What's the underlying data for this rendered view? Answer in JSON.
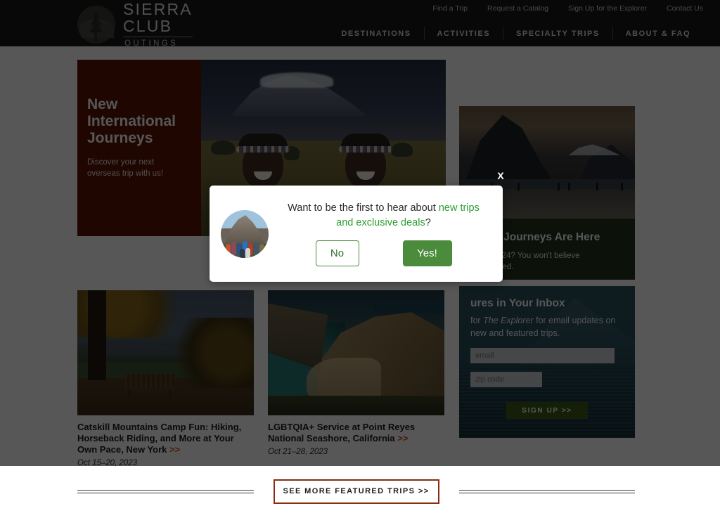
{
  "header": {
    "logo": {
      "line1": "SIERRA",
      "line2": "CLUB",
      "line3": "OUTINGS",
      "mark": "sierra-club-tree-icon"
    },
    "utility_nav": [
      {
        "label": "Find a Trip"
      },
      {
        "label": "Request a Catalog"
      },
      {
        "label": "Sign Up for the Explorer"
      },
      {
        "label": "Contact Us"
      }
    ],
    "main_nav": [
      {
        "label": "DESTINATIONS"
      },
      {
        "label": "ACTIVITIES"
      },
      {
        "label": "SPECIALTY TRIPS"
      },
      {
        "label": "ABOUT & FAQ"
      }
    ]
  },
  "hero": {
    "title": "New International Journeys",
    "subtitle": "Discover your next overseas trip with us!",
    "panel_color": "#5d1405",
    "photo_alt": "two-maasai-women-with-kilimanjaro-photo"
  },
  "side_cards": {
    "journeys": {
      "title": "e New Journeys Are Here",
      "text_line1": "n epic 2024? You won't believe",
      "text_line2": "got planned.",
      "photo_alt": "fjord-mountain-beach-photo"
    },
    "newsletter": {
      "title": "ures in Your Inbox",
      "text_before": "for",
      "text_em": "The Explorer",
      "text_after": "for email updates on new and featured trips.",
      "email_placeholder": "email",
      "email_value": "",
      "zip_placeholder": "zip code",
      "zip_value": "",
      "signup_label": "SIGN UP >>",
      "photo_alt": "lake-and-mountain-photo"
    }
  },
  "featured_trips": [
    {
      "title": "Catskill Mountains Camp Fun: Hiking, Horseback Riding, and More at Your Own Pace, New York",
      "chevron": ">>",
      "date": "Oct 15–20, 2023",
      "photo_alt": "autumn-park-bench-photo"
    },
    {
      "title": "LGBTQIA+ Service at Point Reyes National Seashore, California",
      "chevron": ">>",
      "date": "Oct 21–28, 2023",
      "photo_alt": "coastal-cliffs-cove-photo"
    }
  ],
  "see_more": {
    "label": "SEE MORE FEATURED TRIPS >>",
    "border_color": "#8a2b12"
  },
  "modal": {
    "close_label": "X",
    "avatar_alt": "group-of-hikers-photo",
    "text_part1": "Want to be the first to hear about ",
    "text_highlight": "new trips and exclusive deals",
    "text_part2": "?",
    "no_label": "No",
    "yes_label": "Yes!",
    "accent_green": "#4a8b3c",
    "highlight_green": "#2f9e34"
  }
}
